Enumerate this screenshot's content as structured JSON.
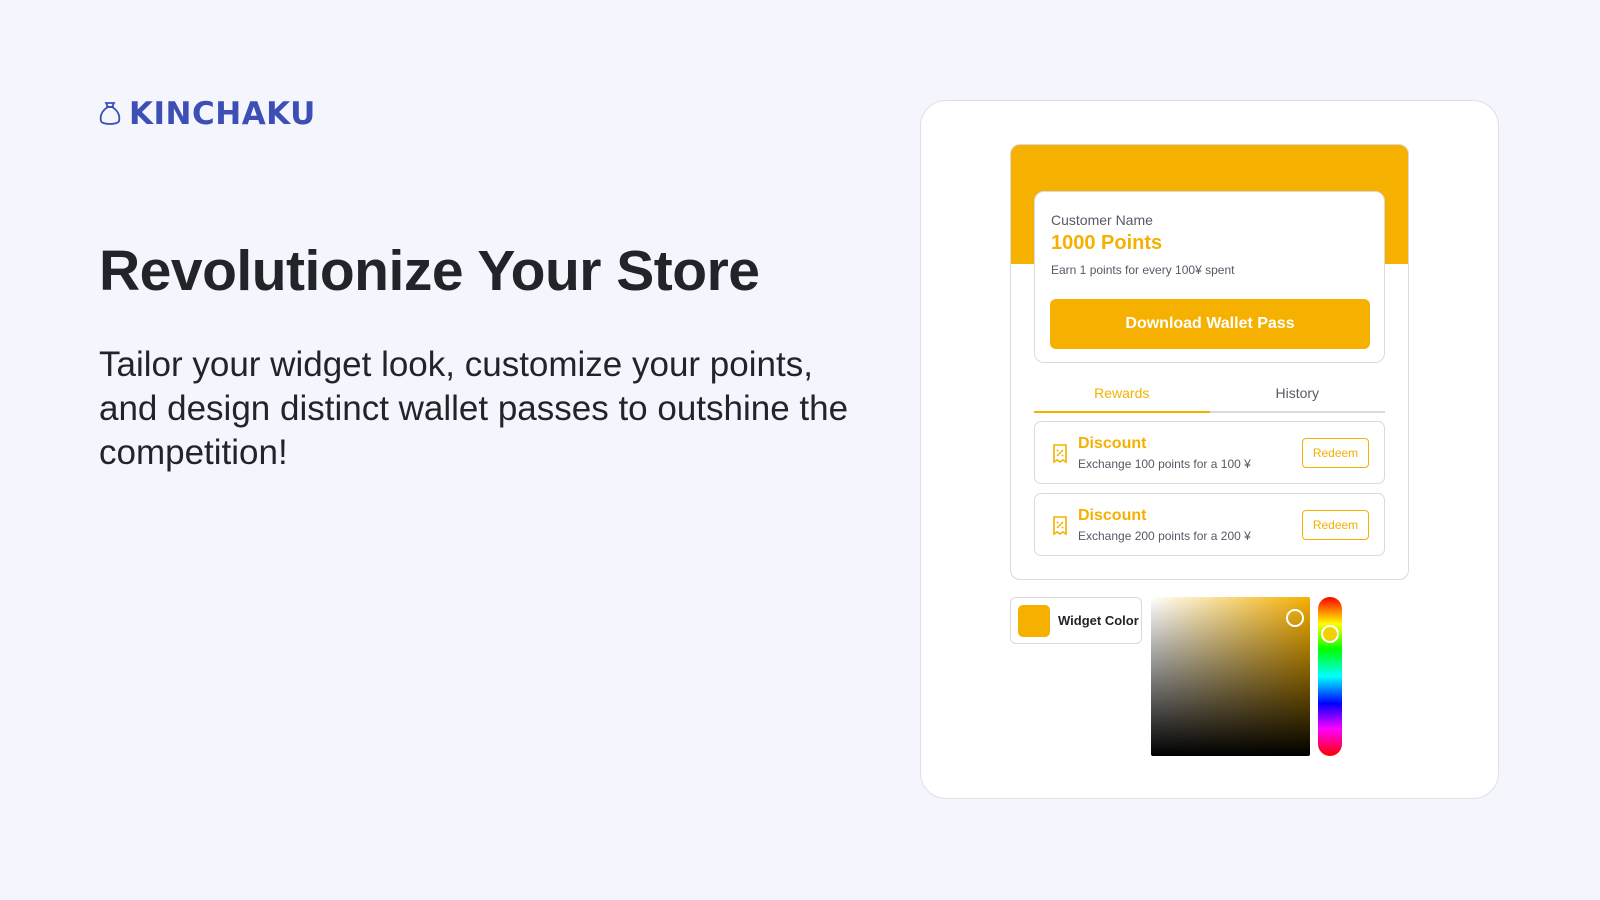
{
  "brand": {
    "name": "KINCHAKU",
    "icon": "money-bag-icon",
    "color": "#3d4fb5"
  },
  "hero": {
    "title": "Revolutionize Your Store",
    "subtitle": "Tailor your widget look, customize your points, and design distinct wallet passes to outshine the competition!"
  },
  "widget": {
    "accent": "#f5b000",
    "customer_name": "Customer Name",
    "points": "1000 Points",
    "earn_text": "Earn 1 points for every 100¥ spent",
    "download_label": "Download Wallet Pass",
    "tabs": [
      {
        "label": "Rewards",
        "active": true
      },
      {
        "label": "History",
        "active": false
      }
    ],
    "rewards": [
      {
        "title": "Discount",
        "description": "Exchange 100 points for a 100 ¥",
        "button": "Redeem",
        "icon": "coupon-icon"
      },
      {
        "title": "Discount",
        "description": "Exchange 200 points for a 200 ¥",
        "button": "Redeem",
        "icon": "coupon-icon"
      }
    ]
  },
  "color_picker": {
    "label": "Widget Color",
    "value": "#f5b000"
  }
}
